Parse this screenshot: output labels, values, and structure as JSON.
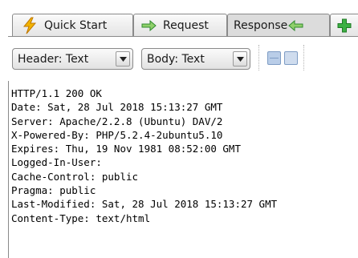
{
  "tabs": [
    {
      "label": "Quick Start",
      "icon": "lightning-icon"
    },
    {
      "label": "Request",
      "icon": "arrow-right-icon"
    },
    {
      "label": "Response",
      "icon": "arrow-left-icon",
      "active": true
    },
    {
      "label": "",
      "icon": "plus-icon"
    }
  ],
  "toolbar": {
    "header_mode": "Header: Text",
    "body_mode": "Body: Text",
    "view_buttons": [
      "split-view-icon",
      "single-view-icon"
    ]
  },
  "response": {
    "lines": [
      "HTTP/1.1 200 OK",
      "Date: Sat, 28 Jul 2018 15:13:27 GMT",
      "Server: Apache/2.2.8 (Ubuntu) DAV/2",
      "X-Powered-By: PHP/5.2.4-2ubuntu5.10",
      "Expires: Thu, 19 Nov 1981 08:52:00 GMT",
      "Logged-In-User:",
      "Cache-Control: public",
      "Pragma: public",
      "Last-Modified: Sat, 28 Jul 2018 15:13:27 GMT",
      "Content-Type: text/html"
    ]
  },
  "colors": {
    "lightning": "#f0b000",
    "arrow_right": "#2fa12f",
    "arrow_left": "#2fa12f",
    "plus": "#22a122",
    "view_button": "#b9cde8"
  }
}
